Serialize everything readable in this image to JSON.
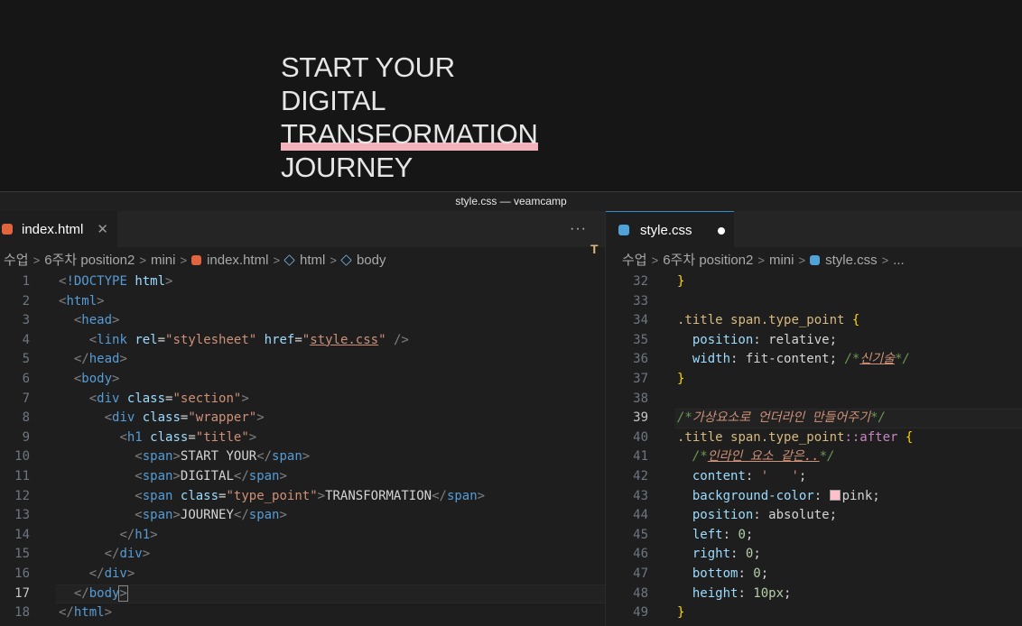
{
  "preview": {
    "lines": [
      "START YOUR",
      "DIGITAL",
      "TRANSFORMATION",
      "JOURNEY"
    ],
    "underline_color": "#f4b3bc"
  },
  "window": {
    "title": "style.css — veamcamp"
  },
  "left_editor": {
    "tab": {
      "label": "index.html",
      "close": "✕"
    },
    "more": "···",
    "breadcrumb": [
      "수업",
      "6주차 position2",
      "mini",
      "index.html",
      "html",
      "body"
    ],
    "current_line": 17
  },
  "right_editor": {
    "tab": {
      "label": "style.css",
      "modified": true
    },
    "breadcrumb": [
      "수업",
      "6주차 position2",
      "mini",
      "style.css",
      "..."
    ],
    "current_line": 39
  },
  "colors": {
    "accent": "#2f8cc9",
    "html_icon": "#e0643d",
    "css_icon": "#4fa3d9",
    "pink": "#ffc0cb"
  }
}
